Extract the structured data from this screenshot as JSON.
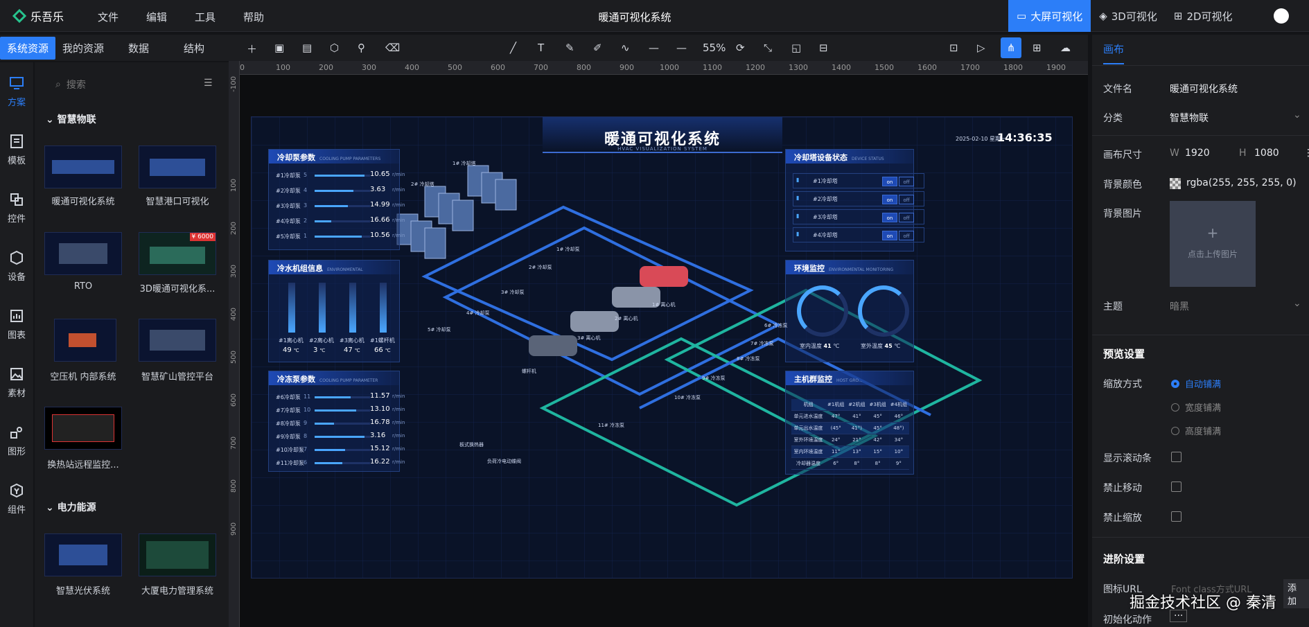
{
  "topbar": {
    "brand": "乐吾乐",
    "menu": [
      "文件",
      "编辑",
      "工具",
      "帮助"
    ],
    "title": "暖通可视化系统",
    "modes": [
      "大屏可视化",
      "3D可视化",
      "2D可视化"
    ]
  },
  "left_tabs": [
    "系统资源",
    "我的资源",
    "数据",
    "结构"
  ],
  "icon_bar": [
    "方案",
    "模板",
    "控件",
    "设备",
    "图表",
    "素材",
    "图形",
    "组件"
  ],
  "left_panel": {
    "search_placeholder": "搜索",
    "group1": "智慧物联",
    "group2": "电力能源",
    "items": [
      "暖通可视化系统",
      "智慧港口可视化",
      "RTO",
      "3D暖通可视化系...",
      "空压机 内部系统",
      "智慧矿山管控平台",
      "换热站远程监控...",
      "智慧光伏系统",
      "大厦电力管理系统"
    ],
    "price_badge": "¥ 6000"
  },
  "toolbar": {
    "zoom": "55%"
  },
  "ruler": {
    "h": [
      "100",
      "200",
      "300",
      "400",
      "500",
      "600",
      "700",
      "800",
      "900",
      "1000",
      "1100",
      "1200",
      "1300",
      "1400",
      "1500",
      "1600",
      "1700",
      "1800",
      "1900"
    ],
    "v": [
      "100",
      "200",
      "300",
      "400",
      "500",
      "600",
      "700",
      "800",
      "900"
    ],
    "h_zero": "0",
    "v_zero": "-100"
  },
  "dashboard": {
    "title": "暖通可视化系统",
    "subtitle": "HVAC VISUALIZATION SYSTEM",
    "date": "2025-02-10  星期一",
    "time": "14:36:35",
    "cooling_pump": {
      "title": "冷却泵参数",
      "sub": "COOLING PUMP PARAMETERS",
      "rows": [
        {
          "name": "#1冷却泵",
          "level": 5,
          "val": "10.65",
          "unit": "r/min",
          "pct": 0.9
        },
        {
          "name": "#2冷却泵",
          "level": 4,
          "val": "3.63",
          "unit": "r/min",
          "pct": 0.7
        },
        {
          "name": "#3冷却泵",
          "level": 3,
          "val": "14.99",
          "unit": "r/min",
          "pct": 0.6
        },
        {
          "name": "#4冷却泵",
          "level": 2,
          "val": "16.66",
          "unit": "r/min",
          "pct": 0.3
        },
        {
          "name": "#5冷却泵",
          "level": 1,
          "val": "10.56",
          "unit": "r/min",
          "pct": 0.85
        }
      ]
    },
    "chiller": {
      "title": "冷水机组信息",
      "sub": "ENVIRONMENTAL",
      "units": [
        {
          "name": "#1离心机",
          "val": "49",
          "unit": "℃"
        },
        {
          "name": "#2离心机",
          "val": "3",
          "unit": "℃"
        },
        {
          "name": "#3离心机",
          "val": "47",
          "unit": "℃"
        },
        {
          "name": "#1螺杆机",
          "val": "66",
          "unit": "℃"
        }
      ]
    },
    "chilled_pump": {
      "title": "冷冻泵参数",
      "sub": "COOLING PUMP PARAMETER",
      "rows": [
        {
          "name": "#6冷却泵",
          "level": 11,
          "val": "11.57",
          "unit": "r/min",
          "pct": 0.65
        },
        {
          "name": "#7冷却泵",
          "level": 10,
          "val": "13.10",
          "unit": "r/min",
          "pct": 0.75
        },
        {
          "name": "#8冷却泵",
          "level": 9,
          "val": "16.78",
          "unit": "r/min",
          "pct": 0.35
        },
        {
          "name": "#9冷却泵",
          "level": 8,
          "val": "3.16",
          "unit": "r/min",
          "pct": 0.9
        },
        {
          "name": "#10冷却泵",
          "level": 7,
          "val": "15.12",
          "unit": "r/min",
          "pct": 0.55
        },
        {
          "name": "#11冷却泵",
          "level": 6,
          "val": "16.22",
          "unit": "r/min",
          "pct": 0.5
        }
      ]
    },
    "tower": {
      "title": "冷却塔设备状态",
      "sub": "DEVICE STATUS",
      "rows": [
        {
          "name": "#1冷却塔",
          "on": "on",
          "off": "off"
        },
        {
          "name": "#2冷却塔",
          "on": "on",
          "off": "off"
        },
        {
          "name": "#3冷却塔",
          "on": "on",
          "off": "off"
        },
        {
          "name": "#4冷却塔",
          "on": "on",
          "off": "off"
        }
      ]
    },
    "env": {
      "title": "环境监控",
      "sub": "ENVIRONMENTAL MONITORING",
      "indoor_label": "室内温度",
      "indoor": "41",
      "outdoor_label": "室外温度",
      "outdoor": "45",
      "unit": "℃"
    },
    "host": {
      "title": "主机群监控",
      "sub": "HOST GRO...",
      "headers": [
        "机组",
        "#1机组",
        "#2机组",
        "#3机组",
        "#4机组"
      ],
      "rows": [
        [
          "单元进水温度",
          "47°",
          "41°",
          "45°",
          "46°"
        ],
        [
          "单元出水温度",
          "(45°",
          "41°)",
          "45°",
          "48°)"
        ],
        [
          "室外环境温度",
          "24°",
          "21°",
          "42°",
          "34°"
        ],
        [
          "室内环境温度",
          "11°",
          "13°",
          "15°",
          "10°"
        ],
        [
          "冷却器温度",
          "6°",
          "8°",
          "8°",
          "9°"
        ]
      ]
    },
    "scene_labels": [
      "1# 冷却塔",
      "2# 冷却塔",
      "1# 冷却泵",
      "2# 冷却泵",
      "3# 冷却泵",
      "4# 冷却泵",
      "5# 冷却泵",
      "1# 离心机",
      "2# 离心机",
      "3# 离心机",
      "螺杆机",
      "6# 冷冻泵",
      "7# 冷冻泵",
      "8# 冷冻泵",
      "9# 冷冻泵",
      "10# 冷冻泵",
      "11# 冷冻泵",
      "板式换热器",
      "负荷冷电动蝶阀"
    ]
  },
  "right_panel": {
    "tab": "画布",
    "file_name_label": "文件名",
    "file_name": "暖通可视化系统",
    "category_label": "分类",
    "category": "智慧物联",
    "size_label": "画布尺寸",
    "w_label": "W",
    "w": "1920",
    "h_label": "H",
    "h": "1080",
    "bg_color_label": "背景颜色",
    "bg_color": "rgba(255, 255, 255, 0)",
    "bg_image_label": "背景图片",
    "upload_text": "点击上传图片",
    "upload_plus": "+",
    "theme_label": "主题",
    "theme": "暗黑",
    "preview_section": "预览设置",
    "zoom_mode_label": "缩放方式",
    "zoom_modes": [
      "自动铺满",
      "宽度铺满",
      "高度铺满"
    ],
    "show_scroll": "显示滚动条",
    "no_move": "禁止移动",
    "no_zoom": "禁止缩放",
    "advanced": "进阶设置",
    "icon_url_label": "图标URL",
    "icon_url_placeholder": "Font class方式URL",
    "add": "添加",
    "init_action": "初始化动作"
  },
  "watermark": "掘金技术社区 @ 秦清",
  "colors": {
    "accent": "#2c7ef8",
    "bg": "#131417"
  }
}
